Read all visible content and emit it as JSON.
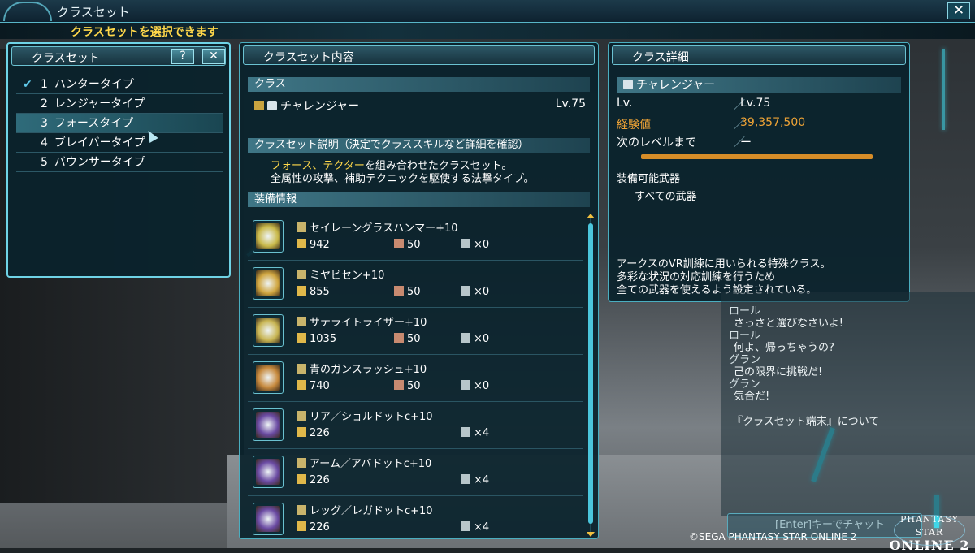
{
  "window": {
    "title": "クラスセット",
    "subtitle": "クラスセットを選択できます",
    "close_label": "✕"
  },
  "classset": {
    "title": "クラスセット",
    "help_label": "?",
    "close_label": "✕",
    "items": [
      {
        "num": "1",
        "label": "ハンタータイプ",
        "checked": true
      },
      {
        "num": "2",
        "label": "レンジャータイプ"
      },
      {
        "num": "3",
        "label": "フォースタイプ",
        "selected": true
      },
      {
        "num": "4",
        "label": "ブレイバータイプ"
      },
      {
        "num": "5",
        "label": "バウンサータイプ"
      }
    ]
  },
  "contents": {
    "title": "クラスセット内容",
    "class_header": "クラス",
    "class_name": "チャレンジャー",
    "class_level": "Lv.75",
    "desc_header": "クラスセット説明（決定でクラススキルなど詳細を確認）",
    "desc_highlight": "フォース、テクター",
    "desc_line1_rest": "を組み合わせたクラスセット。",
    "desc_line2": "全属性の攻撃、補助テクニックを駆使する法撃タイプ。",
    "equip_header": "装備情報",
    "equipment": [
      {
        "name": "セイレーングラスハンマー+10",
        "atk": "942",
        "s2": "50",
        "s3": "×0",
        "color": "#c9b94a"
      },
      {
        "name": "ミヤビセン+10",
        "atk": "855",
        "s2": "50",
        "s3": "×0",
        "color": "#d0a640"
      },
      {
        "name": "サテライトライザー+10",
        "atk": "1035",
        "s2": "50",
        "s3": "×0",
        "color": "#c8b553"
      },
      {
        "name": "青のガンスラッシュ+10",
        "atk": "740",
        "s2": "50",
        "s3": "×0",
        "color": "#c78a3e"
      },
      {
        "name": "リア／ショルドットc+10",
        "atk": "226",
        "s2": "",
        "s3": "×4",
        "color": "#6a4aa2"
      },
      {
        "name": "アーム／アバドットc+10",
        "atk": "226",
        "s2": "",
        "s3": "×4",
        "color": "#6a4aa2"
      },
      {
        "name": "レッグ／レガドットc+10",
        "atk": "226",
        "s2": "",
        "s3": "×4",
        "color": "#6a4aa2"
      }
    ]
  },
  "detail": {
    "title": "クラス詳細",
    "class_name": "チャレンジャー",
    "lv_label": "Lv.",
    "lv_value": "Lv.75",
    "exp_label": "経験値",
    "exp_value": "39,357,500",
    "next_label": "次のレベルまで",
    "next_value": "ー",
    "exp_progress": 1.0,
    "weapons_label": "装備可能武器",
    "weapons_value": "すべての武器",
    "desc_line1": "アークスのVR訓練に用いられる特殊クラス。",
    "desc_line2": "多彩な状況の対応訓練を行うため",
    "desc_line3": "全ての武器を使えるよう設定されている。"
  },
  "chat": {
    "lines": [
      {
        "name": "ロール",
        "text": "さっさと選びなさいよ!"
      },
      {
        "name": "ロール",
        "text": "何よ、帰っちゃうの?"
      },
      {
        "name": "グラン",
        "text": "己の限界に挑戦だ!"
      },
      {
        "name": "グラン",
        "text": "気合だ!"
      }
    ],
    "footer": "『クラスセット端末』について",
    "enter_hint": "[Enter]キーでチャット"
  },
  "footer": {
    "copyright": "©SEGA PHANTASY STAR ONLINE 2",
    "logo_top": "PHANTASY STAR",
    "logo_bottom": "ONLINE 2"
  }
}
